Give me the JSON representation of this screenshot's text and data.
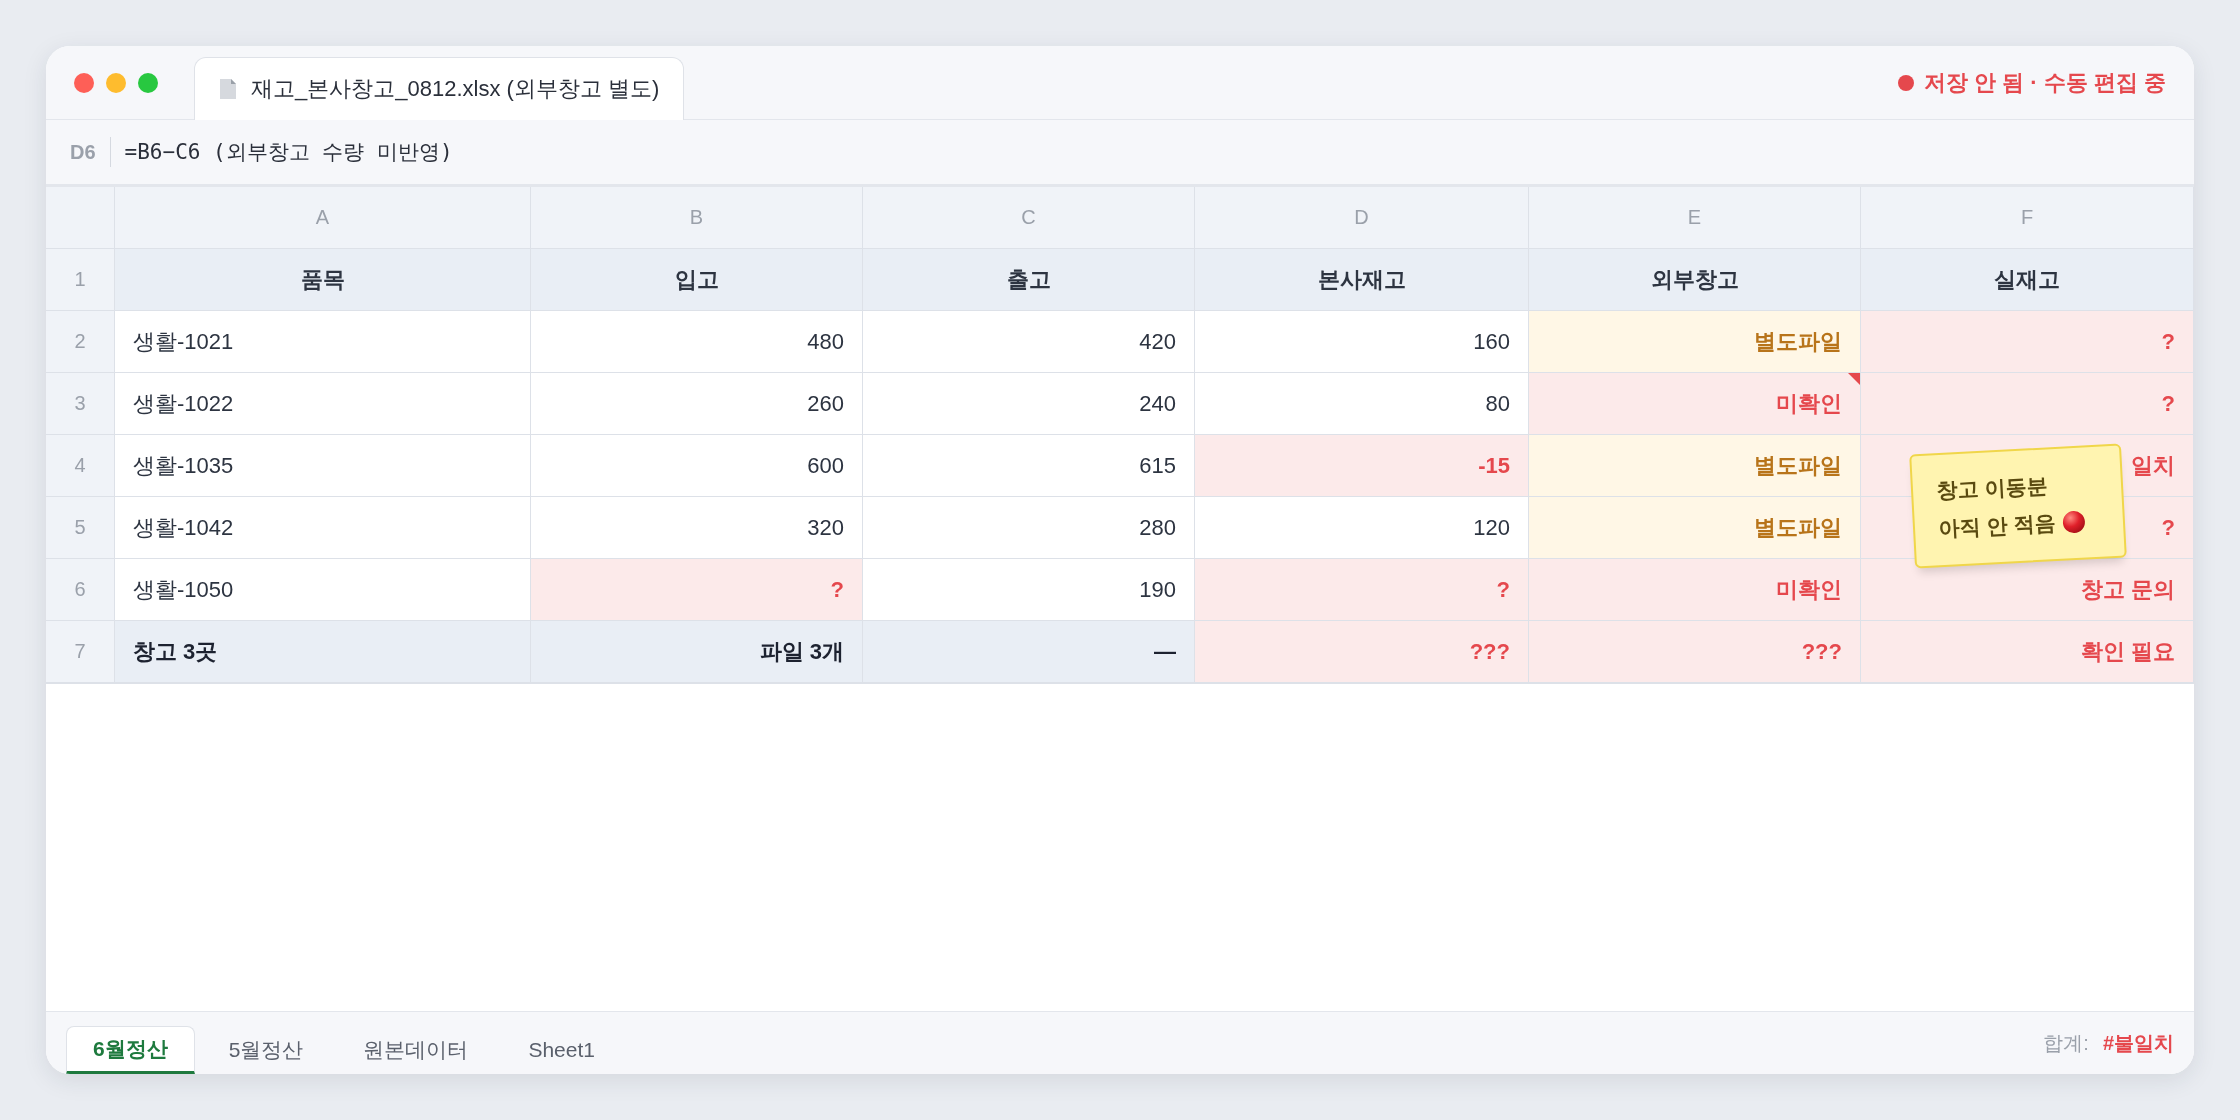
{
  "window": {
    "tab_title": "재고_본사창고_0812.xlsx (외부창고 별도)",
    "status": "저장 안 됨 · 수동 편집 중"
  },
  "formula_bar": {
    "cell_ref": "D6",
    "formula": "=B6−C6 (외부창고 수량 미반영)"
  },
  "table": {
    "columns": [
      "A",
      "B",
      "C",
      "D",
      "E",
      "F"
    ],
    "rows": [
      {
        "number": "1",
        "cells": [
          {
            "text": "품목",
            "kind": "header"
          },
          {
            "text": "입고",
            "kind": "header"
          },
          {
            "text": "출고",
            "kind": "header"
          },
          {
            "text": "본사재고",
            "kind": "header"
          },
          {
            "text": "외부창고",
            "kind": "header"
          },
          {
            "text": "실재고",
            "kind": "header"
          }
        ]
      },
      {
        "number": "2",
        "cells": [
          {
            "text": "생활-1021",
            "kind": "plain"
          },
          {
            "text": "480",
            "kind": "plain"
          },
          {
            "text": "420",
            "kind": "plain"
          },
          {
            "text": "160",
            "kind": "plain"
          },
          {
            "text": "별도파일",
            "kind": "pending"
          },
          {
            "text": "?",
            "kind": "error"
          }
        ]
      },
      {
        "number": "3",
        "cells": [
          {
            "text": "생활-1022",
            "kind": "plain"
          },
          {
            "text": "260",
            "kind": "plain"
          },
          {
            "text": "240",
            "kind": "plain"
          },
          {
            "text": "80",
            "kind": "plain"
          },
          {
            "text": "미확인",
            "kind": "error",
            "comment": true
          },
          {
            "text": "?",
            "kind": "error"
          }
        ]
      },
      {
        "number": "4",
        "cells": [
          {
            "text": "생활-1035",
            "kind": "plain"
          },
          {
            "text": "600",
            "kind": "plain"
          },
          {
            "text": "615",
            "kind": "plain"
          },
          {
            "text": "-15",
            "kind": "error"
          },
          {
            "text": "별도파일",
            "kind": "pending"
          },
          {
            "text": "일치",
            "kind": "error"
          }
        ]
      },
      {
        "number": "5",
        "cells": [
          {
            "text": "생활-1042",
            "kind": "plain"
          },
          {
            "text": "320",
            "kind": "plain"
          },
          {
            "text": "280",
            "kind": "plain"
          },
          {
            "text": "120",
            "kind": "plain"
          },
          {
            "text": "별도파일",
            "kind": "pending"
          },
          {
            "text": "?",
            "kind": "error"
          }
        ]
      },
      {
        "number": "6",
        "cells": [
          {
            "text": "생활-1050",
            "kind": "plain"
          },
          {
            "text": "?",
            "kind": "error"
          },
          {
            "text": "190",
            "kind": "plain"
          },
          {
            "text": "?",
            "kind": "error"
          },
          {
            "text": "미확인",
            "kind": "error"
          },
          {
            "text": "창고 문의",
            "kind": "error"
          }
        ]
      },
      {
        "number": "7",
        "cells": [
          {
            "text": "창고 3곳",
            "kind": "total"
          },
          {
            "text": "파일 3개",
            "kind": "total"
          },
          {
            "text": "—",
            "kind": "total"
          },
          {
            "text": "???",
            "kind": "error"
          },
          {
            "text": "???",
            "kind": "error"
          },
          {
            "text": "확인 필요",
            "kind": "error"
          }
        ]
      }
    ]
  },
  "sticky_note": {
    "lines": [
      "창고 이동분",
      "아직 안 적음"
    ]
  },
  "sheet_tabs": [
    {
      "label": "6월정산",
      "selected": true
    },
    {
      "label": "5월정산",
      "selected": false
    },
    {
      "label": "원본데이터",
      "selected": false
    },
    {
      "label": "Sheet1",
      "selected": false
    }
  ],
  "summary": {
    "label": "합계:",
    "value": "#불일치"
  }
}
